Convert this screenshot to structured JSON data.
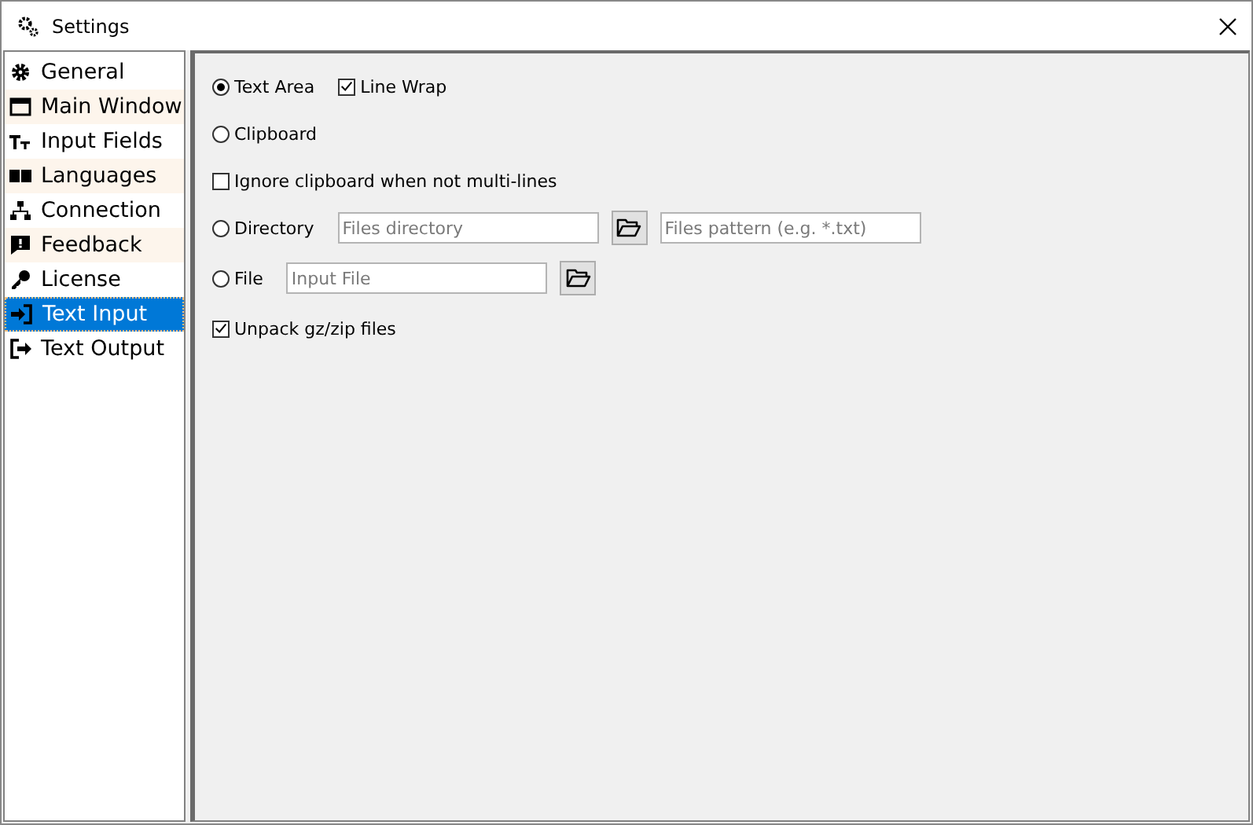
{
  "window": {
    "title": "Settings"
  },
  "sidebar": {
    "items": [
      {
        "label": "General",
        "selected": false
      },
      {
        "label": "Main Window",
        "selected": false
      },
      {
        "label": "Input Fields",
        "selected": false
      },
      {
        "label": "Languages",
        "selected": false
      },
      {
        "label": "Connection",
        "selected": false
      },
      {
        "label": "Feedback",
        "selected": false
      },
      {
        "label": "License",
        "selected": false
      },
      {
        "label": "Text Input",
        "selected": true
      },
      {
        "label": "Text Output",
        "selected": false
      }
    ]
  },
  "rows": [
    [
      {
        "kind": "radio",
        "label": "Text Area",
        "selected": true
      },
      {
        "kind": "checkbox",
        "label": "Line Wrap",
        "checked": true
      }
    ],
    [
      {
        "kind": "radio",
        "label": "Clipboard",
        "selected": false
      }
    ],
    [
      {
        "kind": "checkbox",
        "label": "Ignore clipboard when not multi-lines",
        "checked": false
      }
    ],
    [
      {
        "kind": "radio",
        "label": "Directory",
        "selected": false
      },
      {
        "kind": "field",
        "placeholder": "Files directory"
      },
      {
        "kind": "browse"
      },
      {
        "kind": "field",
        "placeholder": "Files pattern (e.g. *.txt)"
      }
    ],
    [
      {
        "kind": "radio",
        "label": "File",
        "selected": false
      },
      {
        "kind": "field",
        "placeholder": "Input File"
      },
      {
        "kind": "browse"
      }
    ],
    [
      {
        "kind": "checkbox",
        "label": "Unpack gz/zip files",
        "checked": true
      }
    ]
  ]
}
